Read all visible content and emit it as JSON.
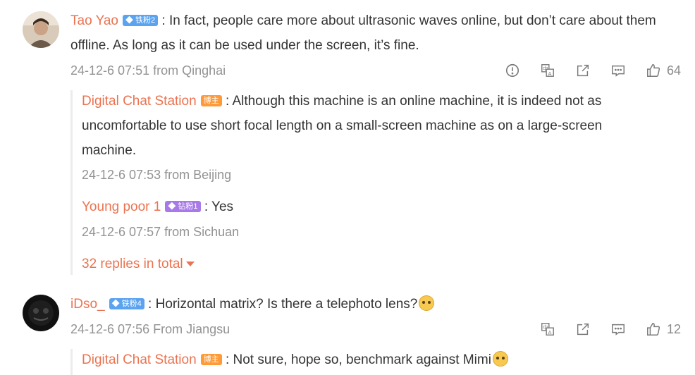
{
  "comments": [
    {
      "user": "Tao Yao",
      "badge": "铁粉2",
      "text": ": In fact, people care more about ultrasonic waves online, but don’t care about them offline. As long as it can be used under the screen, it’s fine.",
      "time": "24-12-6 07:51",
      "sep": "from",
      "location": "Qinghai",
      "likes": "64",
      "replies": [
        {
          "user": "Digital Chat Station",
          "badge": "博主",
          "text": ": Although this machine is an online machine, it is indeed not as uncomfortable to use short focal length on a small-screen machine as on a large-screen machine.",
          "time": "24-12-6 07:53",
          "sep": "from",
          "location": "Beijing"
        },
        {
          "user": "Young poor 1",
          "badge": "钻粉1",
          "text": ": Yes",
          "time": "24-12-6 07:57",
          "sep": "from",
          "location": "Sichuan"
        }
      ],
      "more_replies": "32 replies in total"
    },
    {
      "user": "iDso_",
      "badge": "铁粉4",
      "text": ": Horizontal matrix? Is there a telephoto lens?",
      "time": "24-12-6 07:56",
      "sep": "From",
      "location": "Jiangsu",
      "likes": "12",
      "replies": [
        {
          "user": "Digital Chat Station",
          "badge": "博主",
          "text": ": Not sure, hope so, benchmark against Mimi"
        }
      ]
    }
  ],
  "icons": {
    "report": "report-icon",
    "translate": "translate-icon",
    "share": "share-icon",
    "comment": "comment-icon",
    "like": "thumbs-up-icon",
    "emoji": "doge-emoji-icon"
  },
  "colors": {
    "name": "#eb7350",
    "meta": "#939393",
    "badge_blue": "#5ba3f0",
    "badge_purple": "#a879e8",
    "badge_orange": "#ff9a38"
  }
}
